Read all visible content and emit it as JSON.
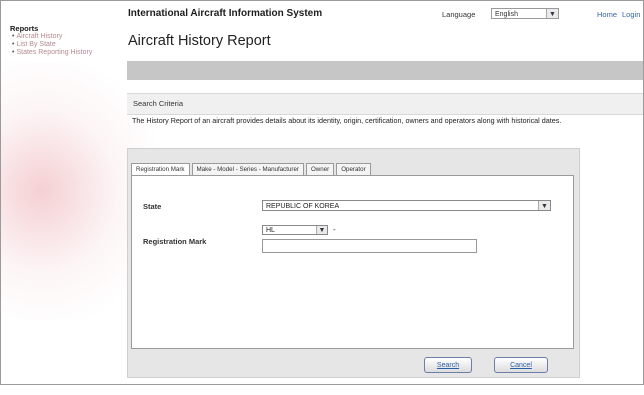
{
  "sidebar": {
    "heading": "Reports",
    "items": [
      {
        "label": "Aircraft History"
      },
      {
        "label": "List By State"
      },
      {
        "label": "States Reporting History"
      }
    ]
  },
  "header": {
    "app_title": "International Aircraft Information System",
    "page_title": "Aircraft History Report",
    "language_label": "Language",
    "language_value": "English",
    "links": [
      "Home",
      "Login"
    ]
  },
  "search": {
    "section_title": "Search Criteria",
    "description": "The History Report of an aircraft provides details about its identity, origin, certification, owners and operators along with historical dates.",
    "tabs": [
      {
        "label": "Registration Mark"
      },
      {
        "label": "Make - Model - Series - Manufacturer"
      },
      {
        "label": "Owner"
      },
      {
        "label": "Operator"
      }
    ],
    "state_label": "State",
    "state_value": "REPUBLIC OF KOREA",
    "registration_label": "Registration Mark",
    "registration_prefix": "HL",
    "registration_separator": "-",
    "registration_value": "",
    "search_button": "Search",
    "cancel_button": "Cancel"
  },
  "colors": {
    "link": "#3465a4",
    "sidebar_link": "#b58a94",
    "gray_bar": "#c6c6c6",
    "panel": "#e6e6e6"
  }
}
